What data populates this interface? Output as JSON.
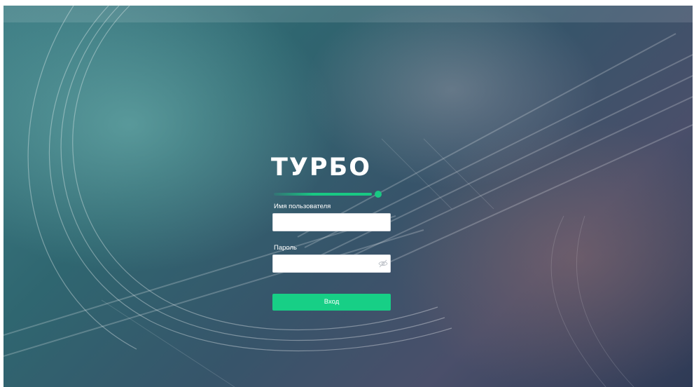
{
  "brand": {
    "name": "ТУРБО",
    "accent": "#19c883"
  },
  "login": {
    "username_label": "Имя пользователя",
    "username_value": "",
    "password_label": "Пароль",
    "password_value": "",
    "password_toggle_icon": "eye-slash-icon",
    "submit_label": "Вход",
    "submit_color": "#17cf86"
  }
}
